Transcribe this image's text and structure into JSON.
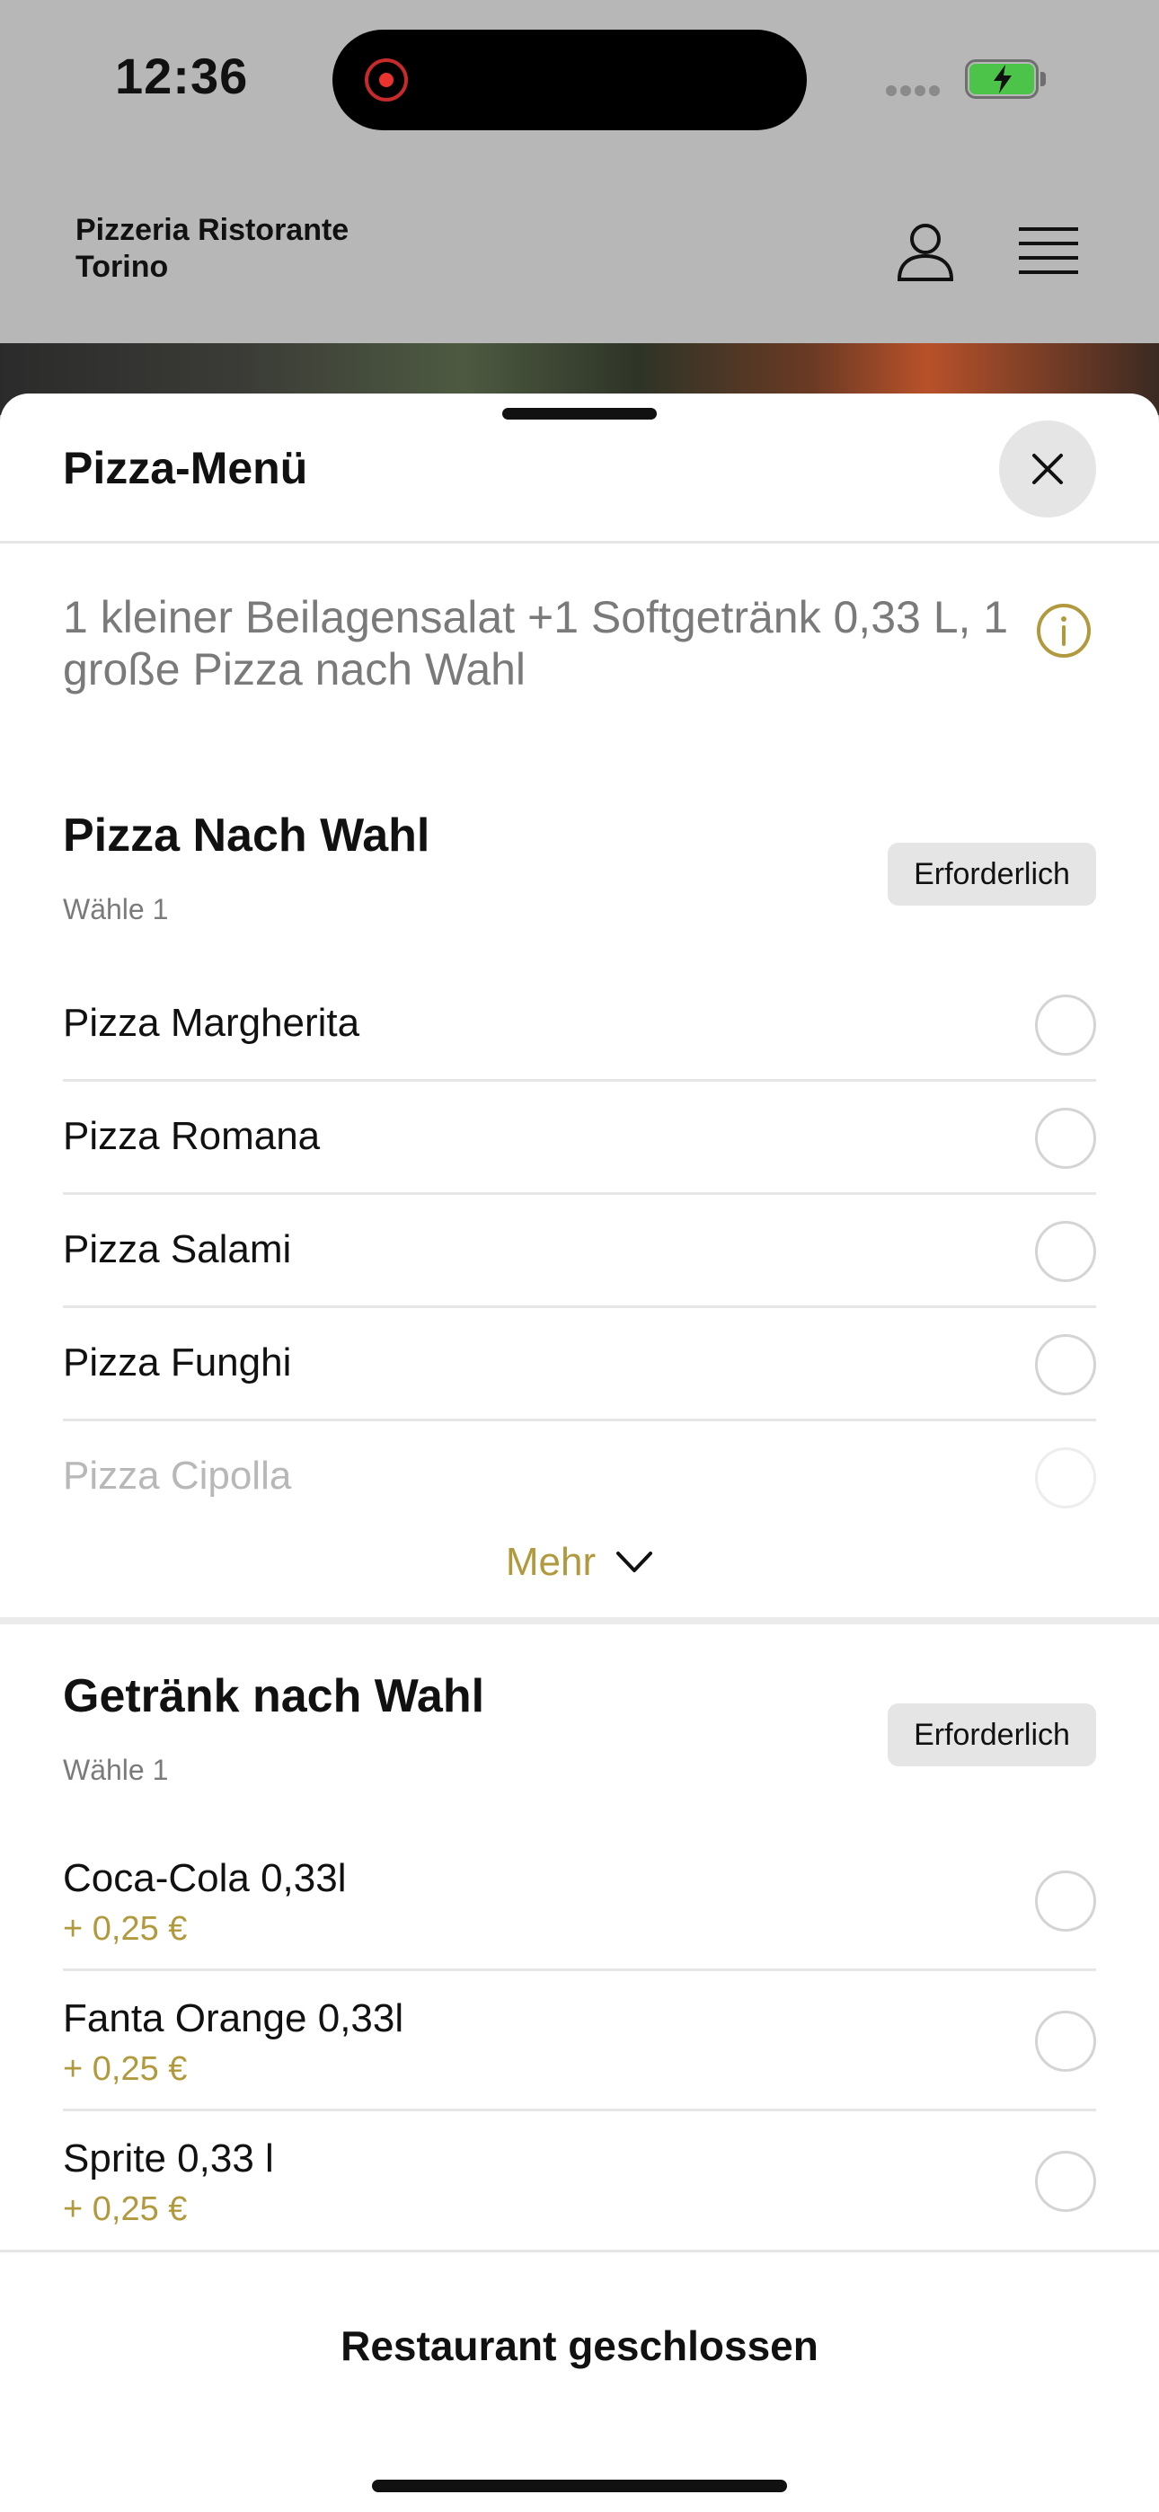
{
  "status_bar": {
    "time": "12:36",
    "battery_color": "#4cc449"
  },
  "header": {
    "brand": "Pizzeria Ristorante\nTorino",
    "icons": [
      "user-icon",
      "menu-icon"
    ]
  },
  "sheet": {
    "title": "Pizza-Menü",
    "description": "1 kleiner Beilagensalat +1 Softgetränk 0,33 L, 1 große Pizza nach Wahl",
    "groups": [
      {
        "title": "Pizza Nach Wahl",
        "subtitle": "Wähle 1",
        "badge": "Erforderlich",
        "options": [
          {
            "label": "Pizza Margherita"
          },
          {
            "label": "Pizza Romana"
          },
          {
            "label": "Pizza Salami"
          },
          {
            "label": "Pizza Funghi"
          },
          {
            "label": "Pizza Cipolla"
          }
        ],
        "more_label": "Mehr"
      },
      {
        "title": "Getränk nach Wahl",
        "subtitle": "Wähle 1",
        "badge": "Erforderlich",
        "options": [
          {
            "label": "Coca-Cola 0,33l",
            "price": "+ 0,25 €"
          },
          {
            "label": "Fanta Orange 0,33l",
            "price": "+ 0,25 €"
          },
          {
            "label": "Sprite 0,33 l",
            "price": "+ 0,25 €"
          }
        ]
      }
    ],
    "footer_status": "Restaurant geschlossen"
  },
  "colors": {
    "accent": "#b19a3e",
    "header_bg": "#b7b7b7",
    "badge_bg": "#e5e5e5"
  }
}
